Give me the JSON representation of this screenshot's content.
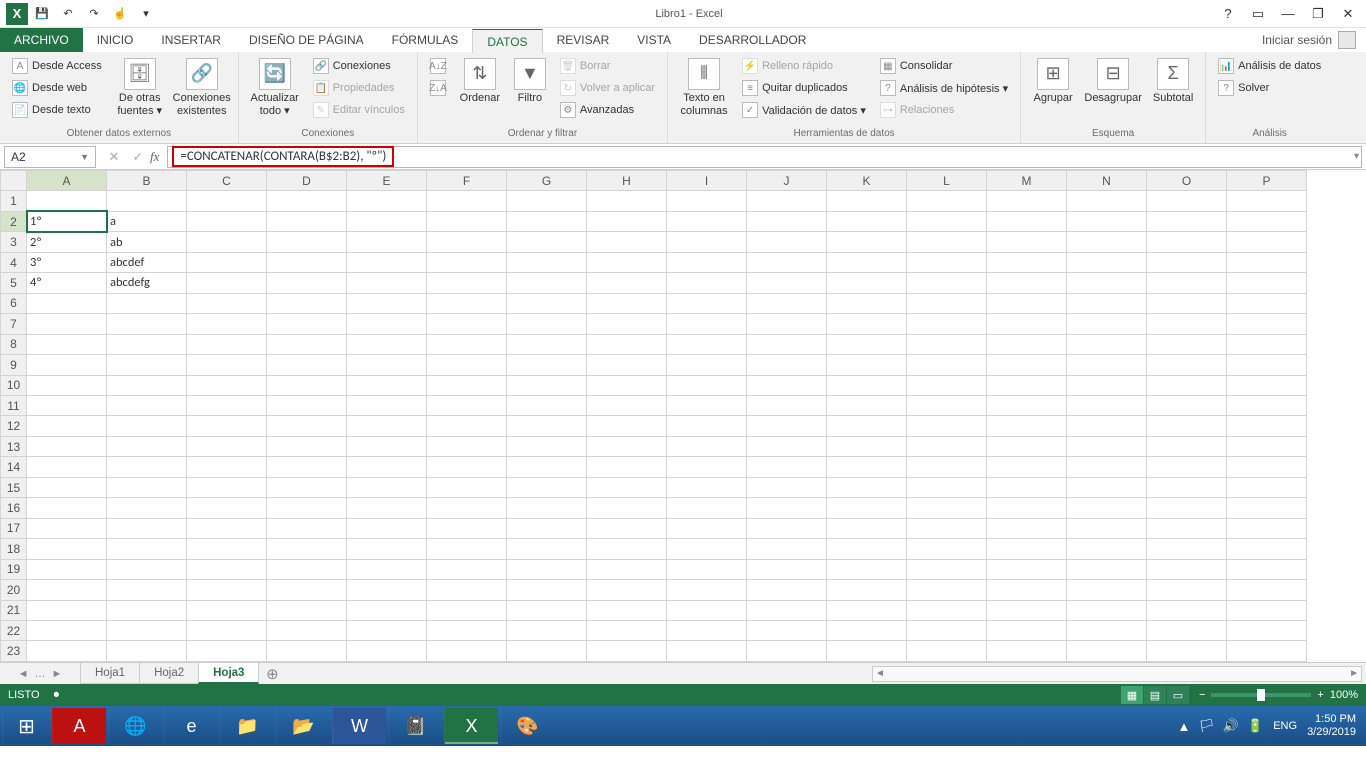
{
  "app": {
    "title": "Libro1 - Excel"
  },
  "qat": {
    "save": "💾",
    "undo": "↶",
    "redo": "↷",
    "touch": "☝"
  },
  "titlebar_icons": {
    "help": "?",
    "ribbon_opts": "▭",
    "min": "—",
    "restore": "❐",
    "close": "✕"
  },
  "menu": {
    "file": "ARCHIVO",
    "tabs": [
      "INICIO",
      "INSERTAR",
      "DISEÑO DE PÁGINA",
      "FÓRMULAS",
      "DATOS",
      "REVISAR",
      "VISTA",
      "DESARROLLADOR"
    ],
    "active": "DATOS",
    "signin": "Iniciar sesión"
  },
  "ribbon": {
    "ext_data": {
      "access": "Desde Access",
      "web": "Desde web",
      "text": "Desde texto",
      "other": "De otras fuentes ▾",
      "conn": "Conexiones existentes",
      "label": "Obtener datos externos"
    },
    "connections": {
      "refresh": "Actualizar todo ▾",
      "conns": "Conexiones",
      "props": "Propiedades",
      "links": "Editar vínculos",
      "label": "Conexiones"
    },
    "sort": {
      "az": "A↓Z",
      "za": "Z↓A",
      "sort": "Ordenar",
      "filter": "Filtro",
      "clear": "Borrar",
      "reapply": "Volver a aplicar",
      "advanced": "Avanzadas",
      "label": "Ordenar y filtrar"
    },
    "data_tools": {
      "text_cols": "Texto en columnas",
      "flash": "Relleno rápido",
      "dupes": "Quitar duplicados",
      "valid": "Validación de datos ▾",
      "consol": "Consolidar",
      "whatif": "Análisis de hipótesis ▾",
      "rel": "Relaciones",
      "label": "Herramientas de datos"
    },
    "outline": {
      "group": "Agrupar",
      "ungroup": "Desagrupar",
      "subtotal": "Subtotal",
      "label": "Esquema"
    },
    "analysis": {
      "da": "Análisis de datos",
      "solver": "Solver",
      "label": "Análisis"
    }
  },
  "namebox": "A2",
  "formula": "=CONCATENAR(CONTARA(B$2:B2), \"º\")",
  "columns": [
    "A",
    "B",
    "C",
    "D",
    "E",
    "F",
    "G",
    "H",
    "I",
    "J",
    "K",
    "L",
    "M",
    "N",
    "O",
    "P"
  ],
  "rows": [
    1,
    2,
    3,
    4,
    5,
    6,
    7,
    8,
    9,
    10,
    11,
    12,
    13,
    14,
    15,
    16,
    17,
    18,
    19,
    20,
    21,
    22,
    23
  ],
  "cells": {
    "A2": "1º",
    "A3": "2º",
    "A4": "3º",
    "A5": "4º",
    "B2": "a",
    "B3": "ab",
    "B4": "abcdef",
    "B5": "abcdefg"
  },
  "active_cell": "A2",
  "sheets": {
    "list": [
      "Hoja1",
      "Hoja2",
      "Hoja3"
    ],
    "active": "Hoja3",
    "add": "⊕"
  },
  "status": {
    "ready": "LISTO",
    "macro": "⏺",
    "lang": "ENG",
    "zoom": "100%",
    "minus": "−",
    "plus": "+"
  },
  "taskbar": {
    "start": "⊞",
    "apps": [
      "A",
      "🌐",
      "e",
      "📁",
      "📂",
      "W",
      "📓",
      "X",
      "🎨"
    ],
    "tray": [
      "▲",
      "🏳",
      "🔊",
      "🔋"
    ],
    "lang": "ENG",
    "time": "1:50 PM",
    "date": "3/29/2019"
  }
}
